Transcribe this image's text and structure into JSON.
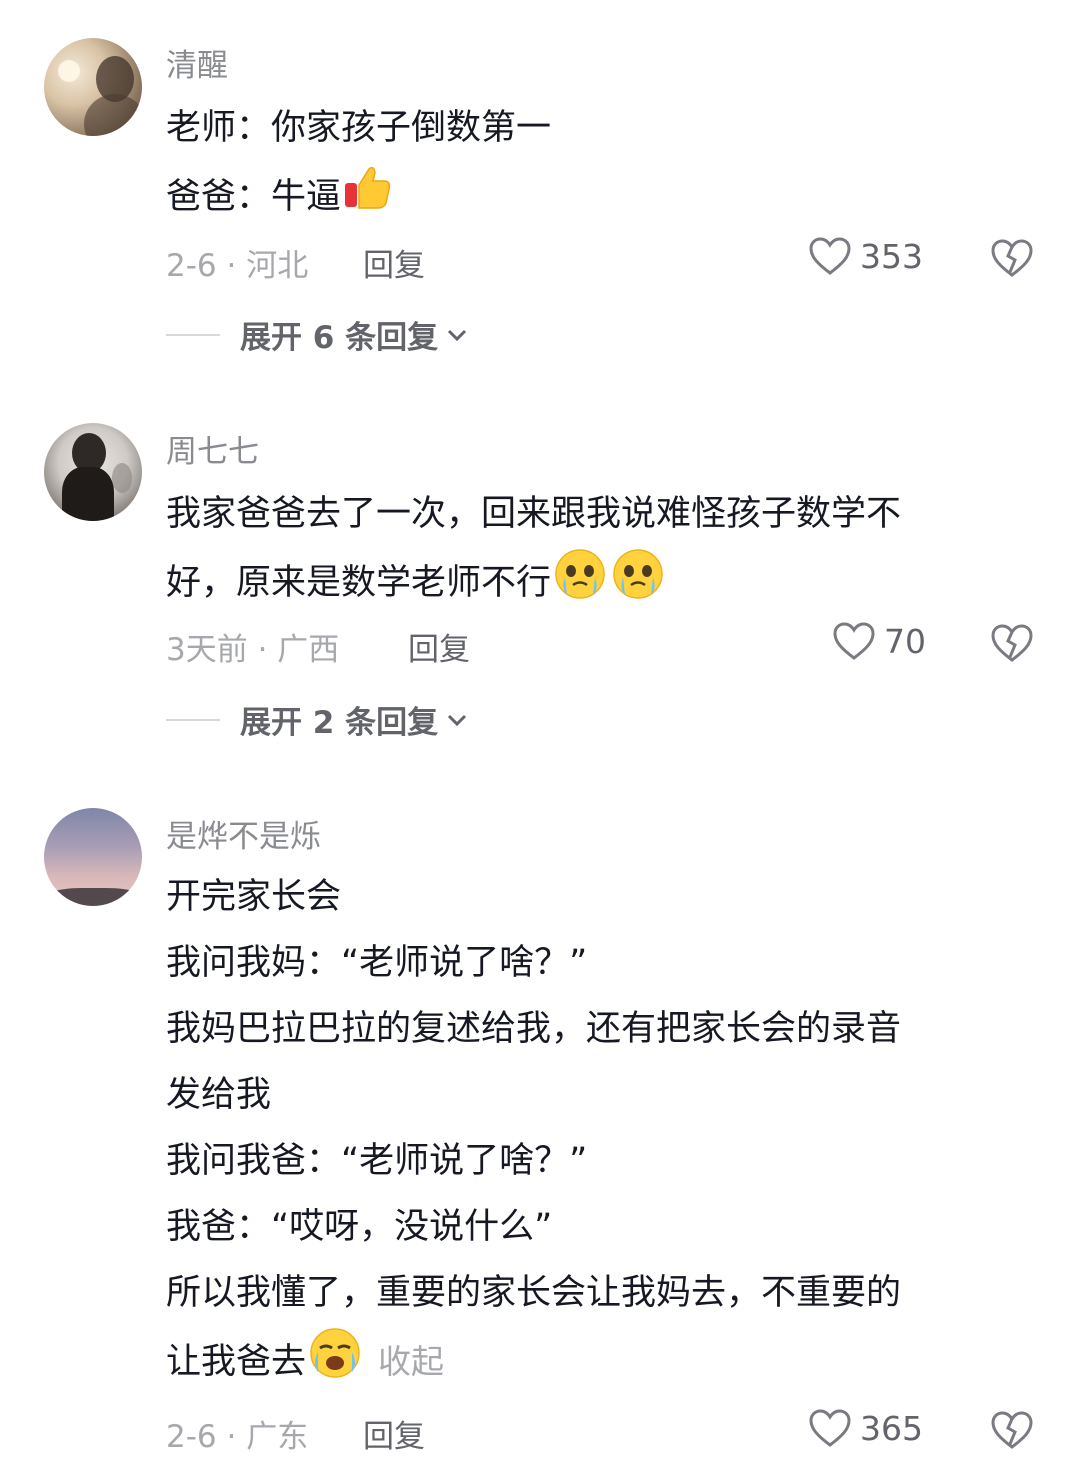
{
  "comments": [
    {
      "username": "清醒",
      "lines": [
        "老师：你家孩子倒数第一",
        "爸爸：牛逼"
      ],
      "meta": "2-6 · 河北",
      "reply_label": "回复",
      "likes": "353",
      "expand_label": "展开 6 条回复"
    },
    {
      "username": "周七七",
      "lines": [
        "我家爸爸去了一次，回来跟我说难怪孩子数学不",
        "好，原来是数学老师不行"
      ],
      "meta": "3天前 · 广西",
      "reply_label": "回复",
      "likes": "70",
      "expand_label": "展开 2 条回复"
    },
    {
      "username": "是烨不是烁",
      "lines": [
        "开完家长会",
        "我问我妈：“老师说了啥？”",
        "我妈巴拉巴拉的复述给我，还有把家长会的录音",
        "发给我",
        "我问我爸：“老师说了啥？”",
        "我爸：“哎呀，没说什么”",
        "所以我懂了，重要的家长会让我妈去，不重要的",
        "让我爸去"
      ],
      "collapse_label": "收起",
      "meta": "2-6 · 广东",
      "reply_label": "回复",
      "likes": "365"
    }
  ],
  "colors": {
    "primary_text": "#161823",
    "secondary_text": "#8a8b91",
    "meta_text": "#a7a8ad",
    "action_text": "#63646b"
  },
  "icons": [
    "heart-outline-icon",
    "broken-heart-icon",
    "thumbs-up-emoji",
    "crying-emoji",
    "chevron-down-icon"
  ]
}
